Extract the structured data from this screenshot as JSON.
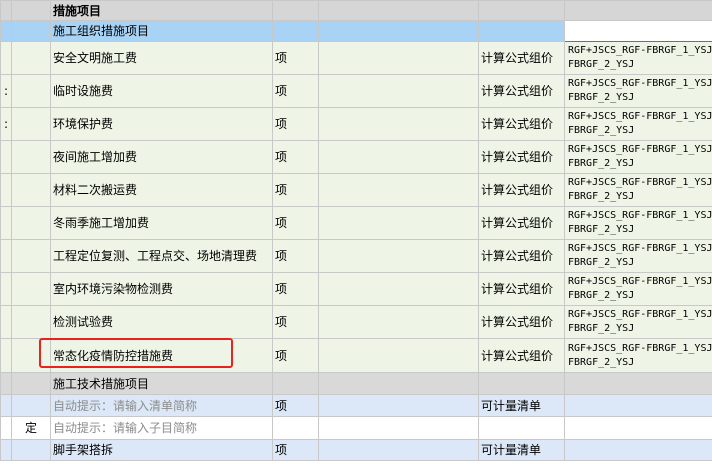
{
  "header": {
    "title": "措施项目"
  },
  "category_org": {
    "name": "施工组织措施项目"
  },
  "items": [
    {
      "marker": "",
      "name": "安全文明施工费",
      "unit": "项",
      "method": "计算公式组价",
      "formula": "RGF+JSCS_RGF-FBRGF_1_YSJ\nFBRGF_2_YSJ"
    },
    {
      "marker": ":",
      "name": "临时设施费",
      "unit": "项",
      "method": "计算公式组价",
      "formula": "RGF+JSCS_RGF-FBRGF_1_YSJ\nFBRGF_2_YSJ"
    },
    {
      "marker": ":",
      "name": "环境保护费",
      "unit": "项",
      "method": "计算公式组价",
      "formula": "RGF+JSCS_RGF-FBRGF_1_YSJ\nFBRGF_2_YSJ"
    },
    {
      "marker": "",
      "name": "夜间施工增加费",
      "unit": "项",
      "method": "计算公式组价",
      "formula": "RGF+JSCS_RGF-FBRGF_1_YSJ\nFBRGF_2_YSJ"
    },
    {
      "marker": "",
      "name": "材料二次搬运费",
      "unit": "项",
      "method": "计算公式组价",
      "formula": "RGF+JSCS_RGF-FBRGF_1_YSJ\nFBRGF_2_YSJ"
    },
    {
      "marker": "",
      "name": "冬雨季施工增加费",
      "unit": "项",
      "method": "计算公式组价",
      "formula": "RGF+JSCS_RGF-FBRGF_1_YSJ\nFBRGF_2_YSJ"
    },
    {
      "marker": "",
      "name": "工程定位复测、工程点交、场地清理费",
      "unit": "项",
      "method": "计算公式组价",
      "formula": "RGF+JSCS_RGF-FBRGF_1_YSJ\nFBRGF_2_YSJ"
    },
    {
      "marker": "",
      "name": "室内环境污染物检测费",
      "unit": "项",
      "method": "计算公式组价",
      "formula": "RGF+JSCS_RGF-FBRGF_1_YSJ\nFBRGF_2_YSJ"
    },
    {
      "marker": "",
      "name": "检测试验费",
      "unit": "项",
      "method": "计算公式组价",
      "formula": "RGF+JSCS_RGF-FBRGF_1_YSJ\nFBRGF_2_YSJ"
    },
    {
      "marker": "",
      "name": "常态化疫情防控措施费",
      "unit": "项",
      "method": "计算公式组价",
      "formula": "RGF+JSCS_RGF-FBRGF_1_YSJ\nFBRGF_2_YSJ"
    }
  ],
  "category_tech": {
    "name": "施工技术措施项目"
  },
  "hint_list": {
    "text": "自动提示：请输入清单简称",
    "unit": "项",
    "method": "可计量清单"
  },
  "hint_sub": {
    "marker": "定",
    "text": "自动提示：请输入子目简称"
  },
  "scaffold": {
    "name": "脚手架搭拆",
    "unit": "项",
    "method": "可计量清单"
  }
}
